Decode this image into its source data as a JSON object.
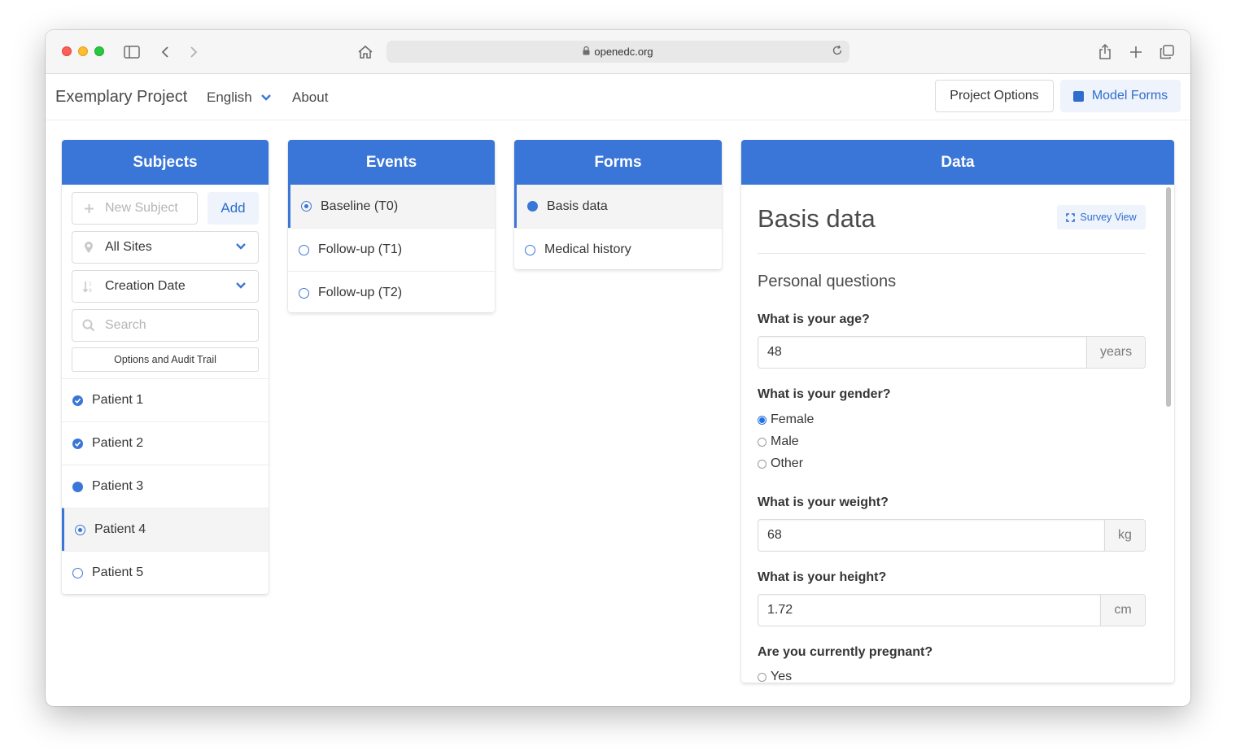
{
  "browser": {
    "url": "openedc.org"
  },
  "navbar": {
    "brand": "Exemplary Project",
    "language": "English",
    "about": "About",
    "project_options": "Project Options",
    "model_forms": "Model Forms"
  },
  "subjects": {
    "title": "Subjects",
    "new_subject_placeholder": "New Subject",
    "add_label": "Add",
    "site_filter": "All Sites",
    "sort_order": "Creation Date",
    "search_placeholder": "Search",
    "audit_label": "Options and Audit Trail",
    "items": [
      {
        "label": "Patient 1",
        "status": "complete"
      },
      {
        "label": "Patient 2",
        "status": "complete"
      },
      {
        "label": "Patient 3",
        "status": "partial"
      },
      {
        "label": "Patient 4",
        "status": "selected"
      },
      {
        "label": "Patient 5",
        "status": "empty"
      }
    ]
  },
  "events": {
    "title": "Events",
    "items": [
      {
        "label": "Baseline (T0)",
        "status": "selected"
      },
      {
        "label": "Follow-up (T1)",
        "status": "empty"
      },
      {
        "label": "Follow-up (T2)",
        "status": "empty"
      }
    ]
  },
  "forms": {
    "title": "Forms",
    "items": [
      {
        "label": "Basis data",
        "status": "partial"
      },
      {
        "label": "Medical history",
        "status": "empty"
      }
    ]
  },
  "data": {
    "title": "Data",
    "form_title": "Basis data",
    "survey_view": "Survey View",
    "section": "Personal questions",
    "age": {
      "question": "What is your age?",
      "value": "48",
      "unit": "years"
    },
    "gender": {
      "question": "What is your gender?",
      "options": [
        "Female",
        "Male",
        "Other"
      ],
      "selected": "Female"
    },
    "weight": {
      "question": "What is your weight?",
      "value": "68",
      "unit": "kg"
    },
    "height": {
      "question": "What is your height?",
      "value": "1.72",
      "unit": "cm"
    },
    "pregnant": {
      "question": "Are you currently pregnant?",
      "options": [
        "Yes"
      ]
    }
  },
  "colors": {
    "accent": "#3a76d8",
    "accent_light": "#eef3fc"
  }
}
